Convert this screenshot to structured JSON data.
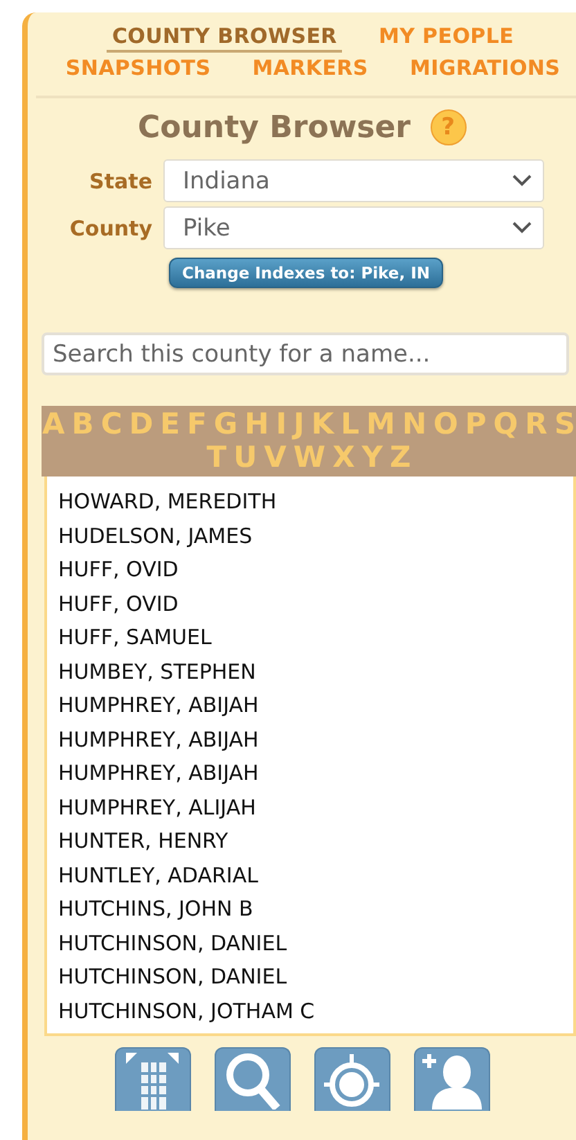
{
  "nav": [
    {
      "label": "COUNTY BROWSER",
      "selected": true
    },
    {
      "label": "MY PEOPLE",
      "selected": false
    },
    {
      "label": "SNAPSHOTS",
      "selected": false
    },
    {
      "label": "MARKERS",
      "selected": false
    },
    {
      "label": "MIGRATIONS",
      "selected": false
    }
  ],
  "title": "County Browser",
  "help": "?",
  "fields": [
    {
      "label": "State",
      "value": "Indiana"
    },
    {
      "label": "County",
      "value": "Pike"
    }
  ],
  "change_button": "Change Indexes to: Pike, IN",
  "search": {
    "placeholder": "Search this county for a name..."
  },
  "letters": [
    "A",
    "B",
    "C",
    "D",
    "E",
    "F",
    "G",
    "H",
    "I",
    "J",
    "K",
    "L",
    "M",
    "N",
    "O",
    "P",
    "Q",
    "R",
    "S",
    "T",
    "U",
    "V",
    "W",
    "X",
    "Y",
    "Z"
  ],
  "names": [
    "HOWARD, MEREDITH",
    "HUDELSON, JAMES",
    "HUFF, OVID",
    "HUFF, OVID",
    "HUFF, SAMUEL",
    "HUMBEY, STEPHEN",
    "HUMPHREY, ABIJAH",
    "HUMPHREY, ABIJAH",
    "HUMPHREY, ABIJAH",
    "HUMPHREY, ALIJAH",
    "HUNTER, HENRY",
    "HUNTLEY, ADARIAL",
    "HUTCHINS, JOHN B",
    "HUTCHINSON, DANIEL",
    "HUTCHINSON, DANIEL",
    "HUTCHINSON, JOTHAM C"
  ],
  "tools": [
    {
      "kind": "map"
    },
    {
      "kind": "search"
    },
    {
      "kind": "target"
    },
    {
      "kind": "person"
    }
  ]
}
